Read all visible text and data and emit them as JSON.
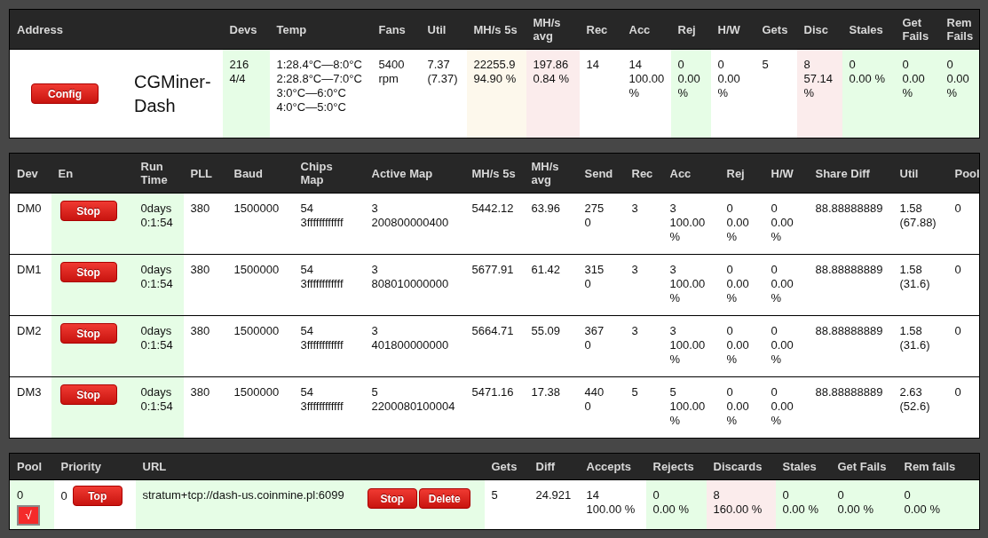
{
  "summary": {
    "columns": [
      {
        "label": "Address"
      },
      {
        "label": "Devs"
      },
      {
        "label": "Temp"
      },
      {
        "label": "Fans"
      },
      {
        "label": "Util"
      },
      {
        "label": "MH/s 5s"
      },
      {
        "label": "MH/s avg"
      },
      {
        "label": "Rec"
      },
      {
        "label": "Acc"
      },
      {
        "label": "Rej"
      },
      {
        "label": "H/W"
      },
      {
        "label": "Gets"
      },
      {
        "label": "Disc"
      },
      {
        "label": "Stales"
      },
      {
        "label": "Get Fails"
      },
      {
        "label": "Rem Fails"
      }
    ],
    "rows": [
      [
        {
          "buttons": [
            "Config"
          ],
          "title": "CGMiner-Dash"
        },
        {
          "lines": [
            "216",
            "4/4"
          ],
          "color": "#e6fde6"
        },
        {
          "lines": [
            "1:28.4°C—8:0°C",
            "2:28.8°C—7:0°C",
            "3:0°C—6:0°C",
            "4:0°C—5:0°C"
          ]
        },
        {
          "lines": [
            "5400",
            "rpm"
          ]
        },
        {
          "lines": [
            "7.37",
            "(7.37)"
          ]
        },
        {
          "lines": [
            "22255.9",
            "94.90 %"
          ],
          "color": "#fdf8ec"
        },
        {
          "lines": [
            "197.86",
            "0.84 %"
          ],
          "color": "#fbecec"
        },
        {
          "lines": [
            "14"
          ]
        },
        {
          "lines": [
            "14",
            "100.00 %"
          ]
        },
        {
          "lines": [
            "0",
            "0.00 %"
          ],
          "color": "#e6fde6"
        },
        {
          "lines": [
            "0",
            "0.00 %"
          ]
        },
        {
          "lines": [
            "5"
          ]
        },
        {
          "lines": [
            "8",
            "57.14 %"
          ],
          "color": "#fbecec"
        },
        {
          "lines": [
            "0",
            "0.00 %"
          ],
          "color": "#e6fde6"
        },
        {
          "lines": [
            "0",
            "0.00 %"
          ],
          "color": "#e6fde6"
        },
        {
          "lines": [
            "0",
            "0.00 %"
          ],
          "color": "#e6fde6"
        }
      ]
    ]
  },
  "devices": {
    "columns": [
      {
        "label": "Dev"
      },
      {
        "label": "En"
      },
      {
        "label": "Run Time"
      },
      {
        "label": "PLL"
      },
      {
        "label": "Baud"
      },
      {
        "label": "Chips Map"
      },
      {
        "label": "Active Map"
      },
      {
        "label": "MH/s 5s"
      },
      {
        "label": "MH/s avg"
      },
      {
        "label": "Send"
      },
      {
        "label": "Rec"
      },
      {
        "label": "Acc"
      },
      {
        "label": "Rej"
      },
      {
        "label": "H/W"
      },
      {
        "label": "Share Diff"
      },
      {
        "label": "Util"
      },
      {
        "label": "Pool"
      }
    ],
    "rows": [
      [
        {
          "lines": [
            "DM0"
          ]
        },
        {
          "buttons": [
            "Stop"
          ],
          "color": "#e6fde6"
        },
        {
          "lines": [
            "0days",
            "0:1:54"
          ],
          "color": "#e6fde6"
        },
        {
          "lines": [
            "380"
          ]
        },
        {
          "lines": [
            "1500000"
          ]
        },
        {
          "lines": [
            "54",
            "3ffffffffffff"
          ]
        },
        {
          "lines": [
            "3",
            "200800000400"
          ]
        },
        {
          "lines": [
            "5442.12"
          ]
        },
        {
          "lines": [
            "63.96"
          ]
        },
        {
          "lines": [
            "275",
            "0"
          ]
        },
        {
          "lines": [
            "3"
          ]
        },
        {
          "lines": [
            "3",
            "100.00 %"
          ]
        },
        {
          "lines": [
            "0",
            "0.00 %"
          ]
        },
        {
          "lines": [
            "0",
            "0.00 %"
          ]
        },
        {
          "lines": [
            "88.88888889"
          ]
        },
        {
          "lines": [
            "1.58",
            "(67.88)"
          ]
        },
        {
          "lines": [
            "0"
          ]
        }
      ],
      [
        {
          "lines": [
            "DM1"
          ]
        },
        {
          "buttons": [
            "Stop"
          ],
          "color": "#e6fde6"
        },
        {
          "lines": [
            "0days",
            "0:1:54"
          ],
          "color": "#e6fde6"
        },
        {
          "lines": [
            "380"
          ]
        },
        {
          "lines": [
            "1500000"
          ]
        },
        {
          "lines": [
            "54",
            "3ffffffffffff"
          ]
        },
        {
          "lines": [
            "3",
            "808010000000"
          ]
        },
        {
          "lines": [
            "5677.91"
          ]
        },
        {
          "lines": [
            "61.42"
          ]
        },
        {
          "lines": [
            "315",
            "0"
          ]
        },
        {
          "lines": [
            "3"
          ]
        },
        {
          "lines": [
            "3",
            "100.00 %"
          ]
        },
        {
          "lines": [
            "0",
            "0.00 %"
          ]
        },
        {
          "lines": [
            "0",
            "0.00 %"
          ]
        },
        {
          "lines": [
            "88.88888889"
          ]
        },
        {
          "lines": [
            "1.58",
            "(31.6)"
          ]
        },
        {
          "lines": [
            "0"
          ]
        }
      ],
      [
        {
          "lines": [
            "DM2"
          ]
        },
        {
          "buttons": [
            "Stop"
          ],
          "color": "#e6fde6"
        },
        {
          "lines": [
            "0days",
            "0:1:54"
          ],
          "color": "#e6fde6"
        },
        {
          "lines": [
            "380"
          ]
        },
        {
          "lines": [
            "1500000"
          ]
        },
        {
          "lines": [
            "54",
            "3ffffffffffff"
          ]
        },
        {
          "lines": [
            "3",
            "401800000000"
          ]
        },
        {
          "lines": [
            "5664.71"
          ]
        },
        {
          "lines": [
            "55.09"
          ]
        },
        {
          "lines": [
            "367",
            "0"
          ]
        },
        {
          "lines": [
            "3"
          ]
        },
        {
          "lines": [
            "3",
            "100.00 %"
          ]
        },
        {
          "lines": [
            "0",
            "0.00 %"
          ]
        },
        {
          "lines": [
            "0",
            "0.00 %"
          ]
        },
        {
          "lines": [
            "88.88888889"
          ]
        },
        {
          "lines": [
            "1.58",
            "(31.6)"
          ]
        },
        {
          "lines": [
            "0"
          ]
        }
      ],
      [
        {
          "lines": [
            "DM3"
          ]
        },
        {
          "buttons": [
            "Stop"
          ],
          "color": "#e6fde6"
        },
        {
          "lines": [
            "0days",
            "0:1:54"
          ],
          "color": "#e6fde6"
        },
        {
          "lines": [
            "380"
          ]
        },
        {
          "lines": [
            "1500000"
          ]
        },
        {
          "lines": [
            "54",
            "3ffffffffffff"
          ]
        },
        {
          "lines": [
            "5",
            "2200080100004"
          ]
        },
        {
          "lines": [
            "5471.16"
          ]
        },
        {
          "lines": [
            "17.38"
          ]
        },
        {
          "lines": [
            "440",
            "0"
          ]
        },
        {
          "lines": [
            "5"
          ]
        },
        {
          "lines": [
            "5",
            "100.00 %"
          ]
        },
        {
          "lines": [
            "0",
            "0.00 %"
          ]
        },
        {
          "lines": [
            "0",
            "0.00 %"
          ]
        },
        {
          "lines": [
            "88.88888889"
          ]
        },
        {
          "lines": [
            "2.63",
            "(52.6)"
          ]
        },
        {
          "lines": [
            "0"
          ]
        }
      ]
    ]
  },
  "pools": {
    "columns": [
      {
        "label": "Pool"
      },
      {
        "label": "Priority"
      },
      {
        "label": "URL"
      },
      {
        "label": "Gets"
      },
      {
        "label": "Diff"
      },
      {
        "label": "Accepts"
      },
      {
        "label": "Rejects"
      },
      {
        "label": "Discards"
      },
      {
        "label": "Stales"
      },
      {
        "label": "Get Fails"
      },
      {
        "label": "Rem fails"
      }
    ],
    "rows": [
      [
        {
          "lines": [
            "0"
          ],
          "checkbox": {
            "label": "√",
            "checked": true
          },
          "color": "#e6fde6"
        },
        {
          "lines": [
            "0"
          ],
          "buttons": [
            "Top"
          ]
        },
        {
          "lines": [
            "stratum+tcp://dash-us.coinmine.pl:6099"
          ],
          "buttons": [
            "Stop",
            "Delete"
          ],
          "color": "#e6fde6"
        },
        {
          "lines": [
            "5"
          ]
        },
        {
          "lines": [
            "24.921"
          ]
        },
        {
          "lines": [
            "14",
            "100.00 %"
          ]
        },
        {
          "lines": [
            "0",
            "0.00 %"
          ],
          "color": "#e6fde6"
        },
        {
          "lines": [
            "8",
            "160.00 %"
          ],
          "color": "#fbecec"
        },
        {
          "lines": [
            "0",
            "0.00 %"
          ],
          "color": "#e6fde6"
        },
        {
          "lines": [
            "0",
            "0.00 %"
          ],
          "color": "#e6fde6"
        },
        {
          "lines": [
            "0",
            "0.00 %"
          ],
          "color": "#e6fde6"
        }
      ]
    ]
  }
}
